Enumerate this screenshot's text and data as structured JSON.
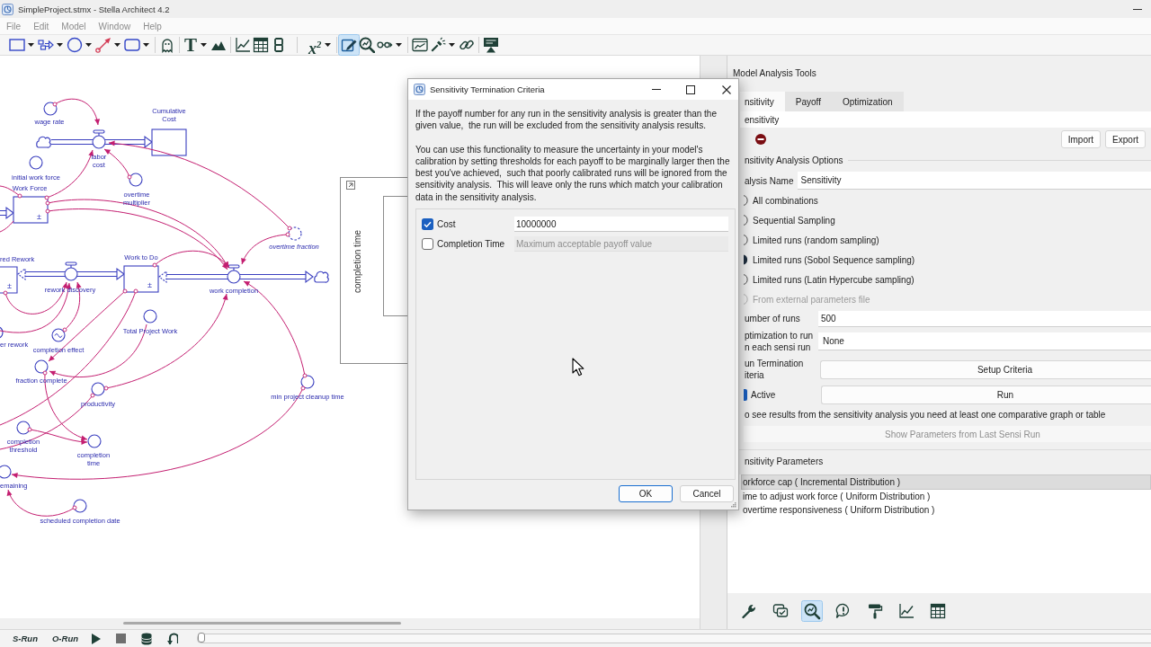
{
  "window": {
    "title": "SimpleProject.stmx - Stella Architect 4.2"
  },
  "menu": [
    {
      "label": "File",
      "disabled": true
    },
    {
      "label": "Edit",
      "disabled": true
    },
    {
      "label": "Model",
      "disabled": true
    },
    {
      "label": "Window",
      "disabled": true
    },
    {
      "label": "Help",
      "disabled": true
    }
  ],
  "toolbar": [
    [
      {
        "kind": "stock",
        "selected": false,
        "dropdown": true
      },
      {
        "kind": "flow",
        "selected": false,
        "dropdown": true
      },
      {
        "kind": "converter",
        "selected": false,
        "dropdown": true
      },
      {
        "kind": "connector",
        "selected": false,
        "dropdown": true
      },
      {
        "kind": "module",
        "selected": false,
        "dropdown": true
      }
    ],
    [
      {
        "kind": "ghost",
        "selected": false,
        "dropdown": false
      }
    ],
    [
      {
        "kind": "text",
        "glyph": "T",
        "selected": false,
        "dropdown": true
      },
      {
        "kind": "image",
        "selected": false,
        "dropdown": false
      }
    ],
    [
      {
        "kind": "graph",
        "selected": false,
        "dropdown": false
      },
      {
        "kind": "table",
        "selected": false,
        "dropdown": false
      },
      {
        "kind": "numeric",
        "selected": false,
        "dropdown": false
      }
    ],
    [
      {
        "kind": "equation",
        "glyph": "x$^{2}$",
        "selected": false,
        "dropdown": true
      }
    ],
    [
      {
        "kind": "edit",
        "selected": true,
        "dropdown": false
      },
      {
        "kind": "analyze",
        "selected": false,
        "dropdown": false
      },
      {
        "kind": "loops",
        "selected": false,
        "dropdown": true
      }
    ],
    [
      {
        "kind": "dashboard",
        "selected": false,
        "dropdown": false
      },
      {
        "kind": "spotlight",
        "selected": false,
        "dropdown": true
      },
      {
        "kind": "link",
        "selected": false,
        "dropdown": false
      }
    ],
    [
      {
        "kind": "presentation",
        "selected": false,
        "dropdown": false
      }
    ]
  ],
  "diagram": {
    "stocks": [
      {
        "label": "Cumulative Cost"
      },
      {
        "label": "Work Force",
        "sign": "±"
      },
      {
        "label": "red Rework",
        "sign": "±"
      },
      {
        "label": "Work to Do",
        "sign": "±"
      }
    ],
    "flows": [
      {
        "label": "labor cost"
      },
      {
        "label": "rework discovery"
      },
      {
        "label": "work completion"
      }
    ],
    "converters": [
      {
        "label": "wage rate",
        "kind": "plain"
      },
      {
        "label": "initial work force",
        "kind": "plain"
      },
      {
        "label": "overtime multiplier",
        "kind": "plain"
      },
      {
        "label": "overtime fraction",
        "kind": "ghost"
      },
      {
        "label": "Total Project Work",
        "kind": "plain"
      },
      {
        "label": "er rework",
        "kind": "plain"
      },
      {
        "label": "completion effect",
        "kind": "graph"
      },
      {
        "label": "fraction complete",
        "kind": "plain"
      },
      {
        "label": "min project cleanup time",
        "kind": "plain"
      },
      {
        "label": "productivity",
        "kind": "plain"
      },
      {
        "label": "completion threshold",
        "kind": "plain"
      },
      {
        "label": "completion time",
        "kind": "plain"
      },
      {
        "label": "emaining",
        "kind": "plain"
      },
      {
        "label": "scheduled completion date",
        "kind": "plain"
      }
    ],
    "graph": {
      "axis_label": "completion time"
    }
  },
  "dialog": {
    "title": "Sensitivity Termination Criteria",
    "paragraphs": [
      "If the payoff number for any run in the sensitivity analysis is greater than the given value,  the run will be excluded from the sensitivity analysis results.",
      "You can use this functionality to measure the uncertainty in your model's calibration by setting thresholds for each payoff to be marginally larger then the best you've achieved,  such that poorly calibrated runs will be ignored from the sensitivity analysis.  This will leave only the runs which match your calibration data in the sensitivity analysis."
    ],
    "criteria": [
      {
        "label": "Cost",
        "checked": true,
        "value": "10000000"
      },
      {
        "label": "Completion Time",
        "checked": false,
        "placeholder": "Maximum acceptable payoff value"
      }
    ],
    "buttons": [
      {
        "label": "OK",
        "default": true
      },
      {
        "label": "Cancel",
        "default": false
      }
    ]
  },
  "panel": {
    "title": "Model Analysis Tools",
    "tabs": [
      {
        "label": "nsitivity",
        "selected": true
      },
      {
        "label": "Payoff",
        "selected": false
      },
      {
        "label": "Optimization",
        "selected": false
      }
    ],
    "analysis_selector": "ensitivity",
    "actions": [
      "Import",
      "Export"
    ],
    "options_heading": "nsitivity Analysis Options",
    "analysis_name": {
      "label": "alysis Name",
      "value": "Sensitivity"
    },
    "sampling": [
      {
        "label": "All combinations",
        "selected": false,
        "disabled": false
      },
      {
        "label": "Sequential Sampling",
        "selected": false,
        "disabled": false
      },
      {
        "label": "Limited runs (random sampling)",
        "selected": false,
        "disabled": false
      },
      {
        "label": "Limited runs (Sobol Sequence sampling)",
        "selected": true,
        "disabled": false
      },
      {
        "label": "Limited runs (Latin Hypercube sampling)",
        "selected": false,
        "disabled": false
      },
      {
        "label": "From external parameters file",
        "selected": false,
        "disabled": true
      }
    ],
    "runs": {
      "label": "umber of runs",
      "value": "500"
    },
    "optimization": {
      "label": [
        "ptimization to run",
        "n each sensi run"
      ],
      "value": "None"
    },
    "termination": {
      "label": [
        "un Termination",
        "iteria"
      ],
      "button": "Setup Criteria"
    },
    "active": {
      "label": "Active",
      "checked": true
    },
    "run_button": "Run",
    "hint": "o see results from the sensitivity analysis you need at least one comparative graph or table",
    "show_parameters": {
      "label": "Show Parameters from Last Sensi Run",
      "disabled": true
    },
    "parameters_heading": "nsitivity Parameters",
    "parameters": [
      {
        "label": "orkforce cap ( Incremental Distribution )",
        "selected": true
      },
      {
        "label": "ime to adjust work force ( Uniform Distribution )",
        "selected": false
      },
      {
        "label": "overtime responsiveness ( Uniform Distribution )",
        "selected": false
      }
    ],
    "tool_tabs": [
      {
        "kind": "tools",
        "selected": false
      },
      {
        "kind": "checks",
        "selected": false
      },
      {
        "kind": "analysis",
        "selected": true
      },
      {
        "kind": "warnings",
        "selected": false
      },
      {
        "kind": "style",
        "selected": false
      },
      {
        "kind": "graph",
        "selected": false
      },
      {
        "kind": "table",
        "selected": false
      }
    ]
  },
  "run_bar": {
    "sim_run": "S-Run",
    "opt_run": "O-Run",
    "slider": {
      "level": 0
    }
  }
}
